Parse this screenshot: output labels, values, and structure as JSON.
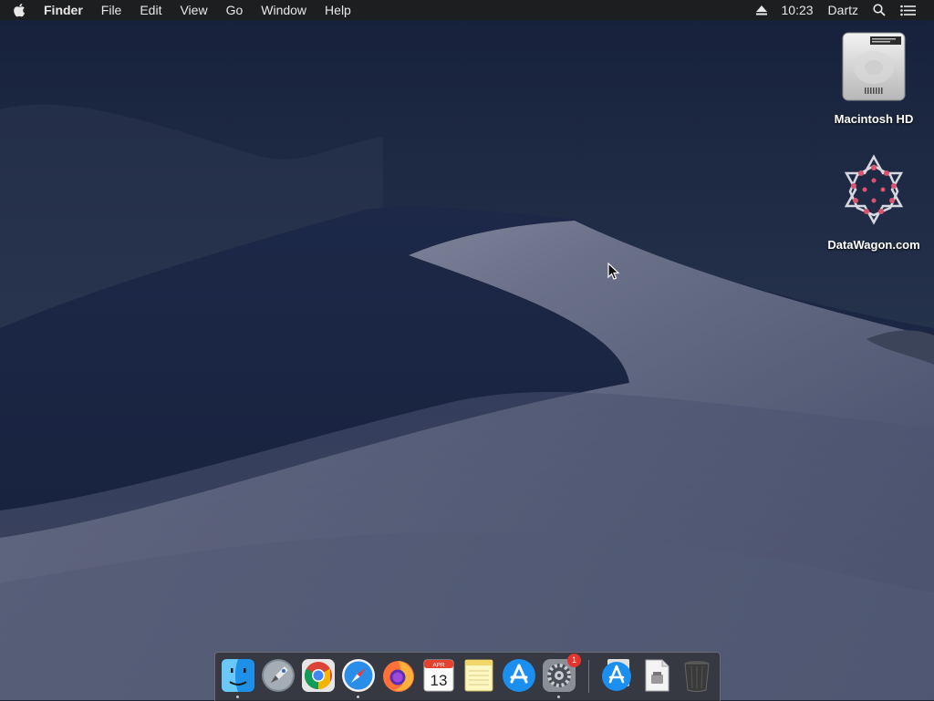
{
  "menubar": {
    "apple_icon": "apple-logo-icon",
    "app_name": "Finder",
    "menus": [
      "File",
      "Edit",
      "View",
      "Go",
      "Window",
      "Help"
    ],
    "status": {
      "eject_icon": "eject-icon",
      "time": "10:23",
      "user": "Dartz",
      "search_icon": "spotlight-search-icon",
      "notifications_icon": "notification-center-icon"
    }
  },
  "desktop": {
    "wallpaper": "macOS Mojave night dunes",
    "icons": [
      {
        "label": "Macintosh HD",
        "icon": "hard-drive-icon"
      },
      {
        "label": "DataWagon.com",
        "icon": "datawagon-logo-icon"
      }
    ]
  },
  "dock": {
    "items": [
      {
        "name": "finder",
        "icon": "finder-icon",
        "running": true
      },
      {
        "name": "launchpad",
        "icon": "launchpad-icon",
        "running": false
      },
      {
        "name": "chrome",
        "icon": "chrome-icon",
        "running": false
      },
      {
        "name": "safari",
        "icon": "safari-icon",
        "running": true
      },
      {
        "name": "firefox",
        "icon": "firefox-icon",
        "running": false
      },
      {
        "name": "calendar",
        "icon": "calendar-icon",
        "running": false,
        "month": "APR",
        "day": "13"
      },
      {
        "name": "notes",
        "icon": "notes-icon",
        "running": false
      },
      {
        "name": "app-store",
        "icon": "app-store-icon",
        "running": false
      },
      {
        "name": "system-preferences",
        "icon": "system-preferences-icon",
        "running": true,
        "badge": "1"
      },
      {
        "name": "downloads-stack",
        "icon": "app-store-icon",
        "running": false
      },
      {
        "name": "document-stack",
        "icon": "document-icon",
        "running": false
      },
      {
        "name": "trash",
        "icon": "trash-icon",
        "running": false
      }
    ]
  },
  "colors": {
    "sky": "#1f2a3f",
    "dune_light": "#7d8398",
    "dune_dark": "#1a2540",
    "menubar": "#1e1e1e",
    "badge": "#e5342e"
  }
}
